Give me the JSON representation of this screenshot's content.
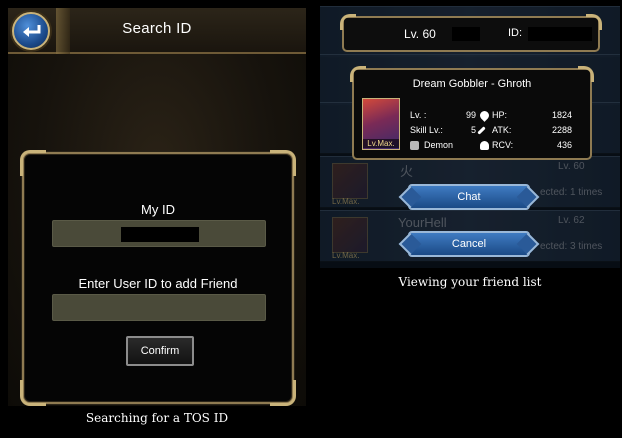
{
  "left": {
    "header": {
      "title": "Search ID",
      "back_icon": "back-arrow-icon"
    },
    "dialog": {
      "my_id_label": "My ID",
      "my_id_value": "",
      "enter_label": "Enter User ID to add Friend",
      "enter_value": "",
      "confirm_label": "Confirm"
    },
    "caption": "Searching for a TOS ID"
  },
  "right": {
    "top_bar": {
      "level": "Lv. 60",
      "id_label": "ID:"
    },
    "monster": {
      "name": "Dream Gobbler - Ghroth",
      "card_tag": "Lv.Max.",
      "lv_label": "Lv. :",
      "lv_value": "99",
      "skill_label": "Skill Lv.:",
      "skill_value": "5",
      "attribute_label": "Demon",
      "hp_label": "HP:",
      "hp_value": "1824",
      "atk_label": "ATK:",
      "atk_value": "2288",
      "rcv_label": "RCV:",
      "rcv_value": "436"
    },
    "buttons": {
      "chat": "Chat",
      "cancel": "Cancel"
    },
    "background_rows": [
      {
        "name": "",
        "level": "",
        "sub": "",
        "card_tag": ""
      },
      {
        "name": "火",
        "level": "Lv. 60",
        "sub": "ected: 1 times",
        "card_tag": "Lv.Max."
      },
      {
        "name": "YourHell",
        "level": "Lv. 62",
        "sub": "ected: 3 times",
        "card_tag": "Lv.Max."
      }
    ],
    "caption": "Viewing your friend list"
  },
  "colors": {
    "gold_border": "#8f7b52",
    "button_blue": "#1b4a86",
    "field": "#4a4a39"
  }
}
